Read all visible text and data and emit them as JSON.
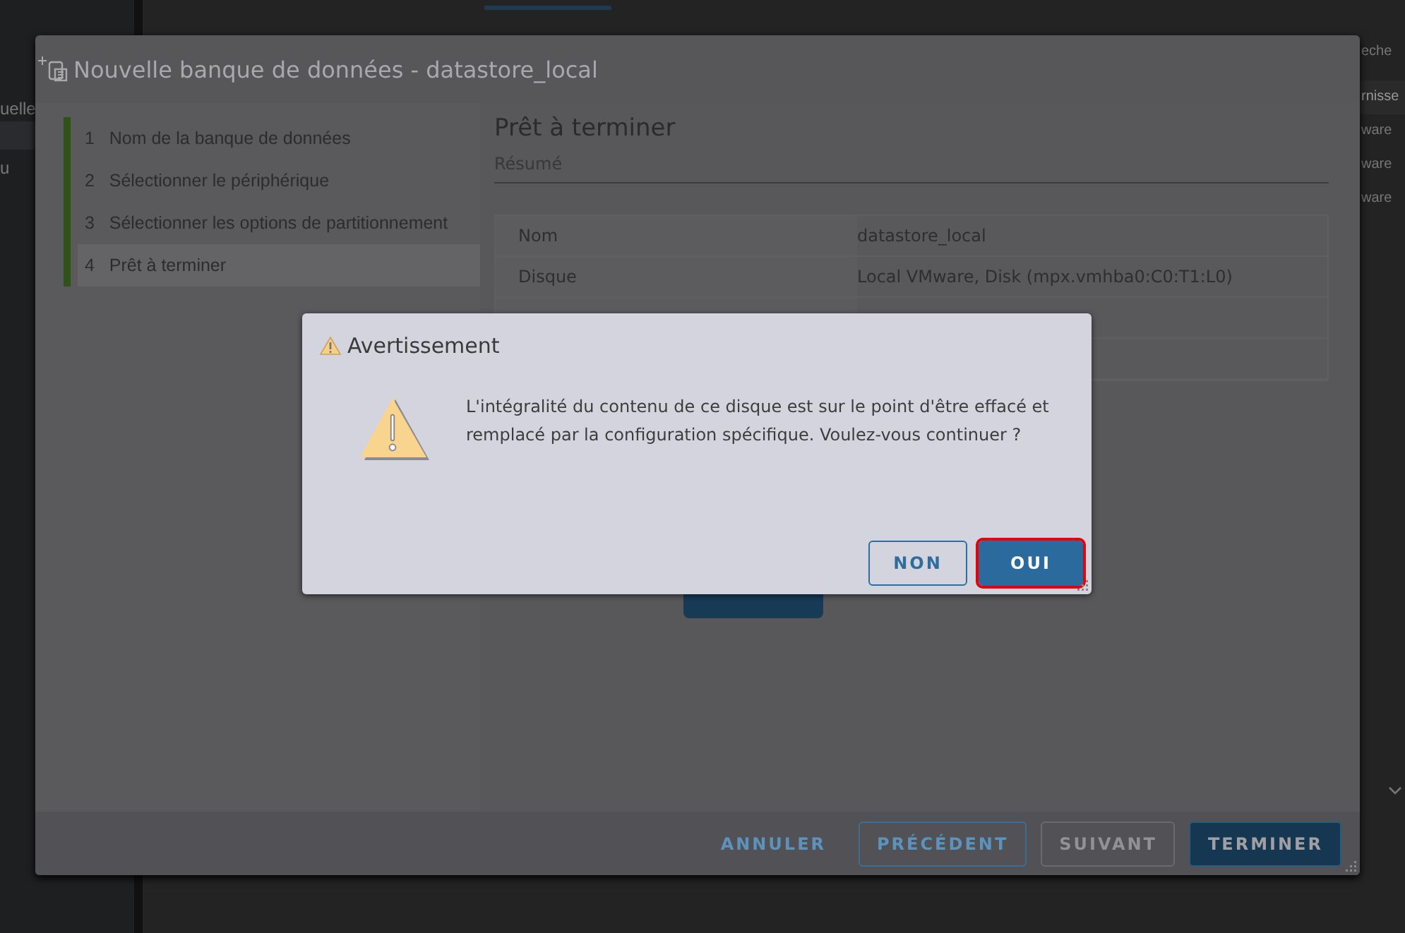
{
  "background": {
    "left_texts": [
      "uelle",
      "u"
    ],
    "right_texts": [
      "eche",
      "rnisse",
      "ware",
      "ware",
      "ware"
    ]
  },
  "wizard": {
    "title": "Nouvelle banque de données - datastore_local",
    "steps": [
      {
        "number": "1",
        "label": "Nom de la banque de données",
        "selected": false
      },
      {
        "number": "2",
        "label": "Sélectionner le périphérique",
        "selected": false
      },
      {
        "number": "3",
        "label": "Sélectionner les options de partitionnement",
        "selected": false
      },
      {
        "number": "4",
        "label": "Prêt à terminer",
        "selected": true
      }
    ],
    "heading": "Prêt à terminer",
    "subheading": "Résumé",
    "summary_rows": [
      {
        "name": "Nom",
        "value": "datastore_local"
      },
      {
        "name": "Disque",
        "value": "Local VMware, Disk (mpx.vmhba0:C0:T1:L0)"
      },
      {
        "name": "",
        "value": ""
      },
      {
        "name": "",
        "value": ""
      }
    ],
    "buttons": [
      {
        "label": "ANNULER",
        "kind": "flat",
        "disabled": false
      },
      {
        "label": "PRÉCÉDENT",
        "kind": "outline",
        "disabled": false
      },
      {
        "label": "SUIVANT",
        "kind": "outline",
        "disabled": true
      },
      {
        "label": "TERMINER",
        "kind": "primary",
        "disabled": false
      }
    ]
  },
  "dialog": {
    "title": "Avertissement",
    "message": "L'intégralité du contenu de ce disque est sur le point d'être effacé et remplacé par la configuration spécifique. Voulez-vous continuer ?",
    "buttons": [
      {
        "label": "NON",
        "kind": "outline",
        "highlighted": false
      },
      {
        "label": "OUI",
        "kind": "primary",
        "highlighted": true
      }
    ]
  }
}
